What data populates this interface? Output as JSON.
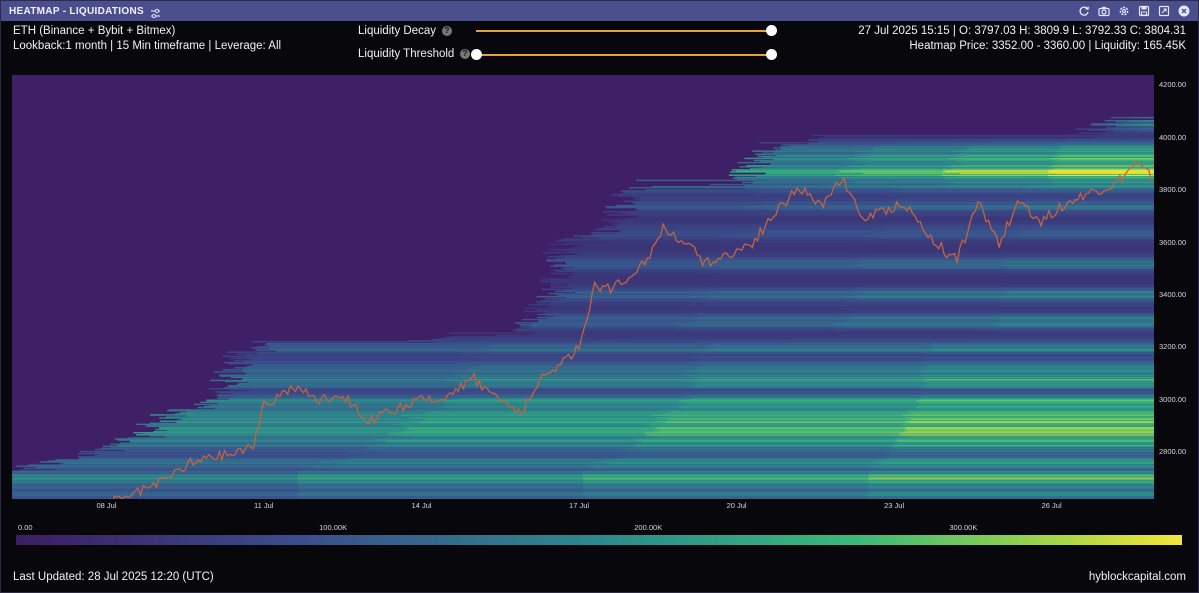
{
  "window": {
    "title": "HEATMAP - LIQUIDATIONS",
    "icons": [
      "tune-icon",
      "refresh-icon",
      "camera-icon",
      "settings-icon",
      "save-icon",
      "expand-icon",
      "close-icon"
    ]
  },
  "header": {
    "exchanges": "ETH (Binance + Bybit + Bitmex)",
    "lookback": "Lookback:1 month | 15 Min timeframe | Leverage: All",
    "ohlc": "27 Jul 2025 15:15 | O: 3797.03 H: 3809.9 L: 3792.33 C: 3804.31",
    "heatmap_info": "Heatmap Price: 3352.00 - 3360.00 | Liquidity: 165.45K"
  },
  "controls": {
    "decay_label": "Liquidity Decay",
    "decay_value": 1.0,
    "threshold_label": "Liquidity Threshold",
    "threshold_value": [
      0.0,
      1.0
    ],
    "help_glyph": "?"
  },
  "colors": {
    "accent": "#e8a23c",
    "titlebar": "#4a4e8c",
    "candle_up": "#3fa66b",
    "candle_down": "#e0553a"
  },
  "chart_data": {
    "type": "heatmap",
    "title": "",
    "xlabel": "",
    "ylabel": "",
    "x_ticks": [
      "08 Jul",
      "11 Jul",
      "14 Jul",
      "17 Jul",
      "20 Jul",
      "23 Jul",
      "26 Jul"
    ],
    "y_ticks": [
      "4200.00",
      "4000.00",
      "3800.00",
      "3600.00",
      "3400.00",
      "3200.00",
      "3000.00",
      "2800.00"
    ],
    "ylim": [
      2620,
      4240
    ],
    "colorbar_ticks": [
      "0.00",
      "100.00K",
      "200.00K",
      "300.00K"
    ],
    "colorbar_range": [
      0,
      370000
    ],
    "price_path": [
      {
        "day": 6.0,
        "price": 2530
      },
      {
        "day": 7.0,
        "price": 2560
      },
      {
        "day": 7.8,
        "price": 2600
      },
      {
        "day": 8.3,
        "price": 2620
      },
      {
        "day": 9.0,
        "price": 2680
      },
      {
        "day": 9.3,
        "price": 2720
      },
      {
        "day": 9.6,
        "price": 2760
      },
      {
        "day": 10.0,
        "price": 2780
      },
      {
        "day": 10.5,
        "price": 2800
      },
      {
        "day": 10.8,
        "price": 2830
      },
      {
        "day": 11.0,
        "price": 2980
      },
      {
        "day": 11.3,
        "price": 3020
      },
      {
        "day": 11.6,
        "price": 3050
      },
      {
        "day": 12.0,
        "price": 3000
      },
      {
        "day": 12.5,
        "price": 3020
      },
      {
        "day": 13.0,
        "price": 2920
      },
      {
        "day": 13.5,
        "price": 2960
      },
      {
        "day": 14.0,
        "price": 3000
      },
      {
        "day": 14.3,
        "price": 2990
      },
      {
        "day": 14.6,
        "price": 3040
      },
      {
        "day": 15.0,
        "price": 3080
      },
      {
        "day": 15.5,
        "price": 3000
      },
      {
        "day": 15.9,
        "price": 2950
      },
      {
        "day": 16.3,
        "price": 3080
      },
      {
        "day": 16.7,
        "price": 3150
      },
      {
        "day": 17.0,
        "price": 3200
      },
      {
        "day": 17.3,
        "price": 3440
      },
      {
        "day": 17.6,
        "price": 3420
      },
      {
        "day": 18.0,
        "price": 3480
      },
      {
        "day": 18.3,
        "price": 3540
      },
      {
        "day": 18.6,
        "price": 3650
      },
      {
        "day": 19.0,
        "price": 3610
      },
      {
        "day": 19.4,
        "price": 3520
      },
      {
        "day": 19.9,
        "price": 3560
      },
      {
        "day": 20.3,
        "price": 3600
      },
      {
        "day": 20.8,
        "price": 3730
      },
      {
        "day": 21.2,
        "price": 3810
      },
      {
        "day": 21.6,
        "price": 3740
      },
      {
        "day": 22.0,
        "price": 3850
      },
      {
        "day": 22.4,
        "price": 3690
      },
      {
        "day": 22.8,
        "price": 3720
      },
      {
        "day": 23.2,
        "price": 3750
      },
      {
        "day": 23.6,
        "price": 3640
      },
      {
        "day": 24.0,
        "price": 3560
      },
      {
        "day": 24.2,
        "price": 3540
      },
      {
        "day": 24.6,
        "price": 3750
      },
      {
        "day": 25.0,
        "price": 3600
      },
      {
        "day": 25.4,
        "price": 3760
      },
      {
        "day": 25.8,
        "price": 3680
      },
      {
        "day": 26.2,
        "price": 3740
      },
      {
        "day": 26.7,
        "price": 3790
      },
      {
        "day": 27.2,
        "price": 3820
      },
      {
        "day": 27.6,
        "price": 3900
      },
      {
        "day": 27.9,
        "price": 3850
      }
    ],
    "liquidity_bands": [
      {
        "price": 4210,
        "value": 95000
      },
      {
        "price": 4150,
        "value": 140000
      },
      {
        "price": 4060,
        "value": 190000
      },
      {
        "price": 3960,
        "value": 175000
      },
      {
        "price": 3920,
        "value": 230000
      },
      {
        "price": 3870,
        "value": 350000
      },
      {
        "price": 3820,
        "value": 160000
      },
      {
        "price": 3740,
        "value": 110000
      },
      {
        "price": 3640,
        "value": 90000
      },
      {
        "price": 3520,
        "value": 120000
      },
      {
        "price": 3400,
        "value": 150000
      },
      {
        "price": 3300,
        "value": 170000
      },
      {
        "price": 3200,
        "value": 150000
      },
      {
        "price": 3120,
        "value": 185000
      },
      {
        "price": 3070,
        "value": 240000
      },
      {
        "price": 2990,
        "value": 270000
      },
      {
        "price": 2930,
        "value": 310000
      },
      {
        "price": 2880,
        "value": 330000
      },
      {
        "price": 2830,
        "value": 230000
      },
      {
        "price": 2760,
        "value": 200000
      },
      {
        "price": 2700,
        "value": 260000
      },
      {
        "price": 2640,
        "value": 180000
      }
    ]
  },
  "footer": {
    "last_updated": "Last Updated: 28 Jul 2025 12:20 (UTC)",
    "brand": "hyblockcapital.com"
  }
}
